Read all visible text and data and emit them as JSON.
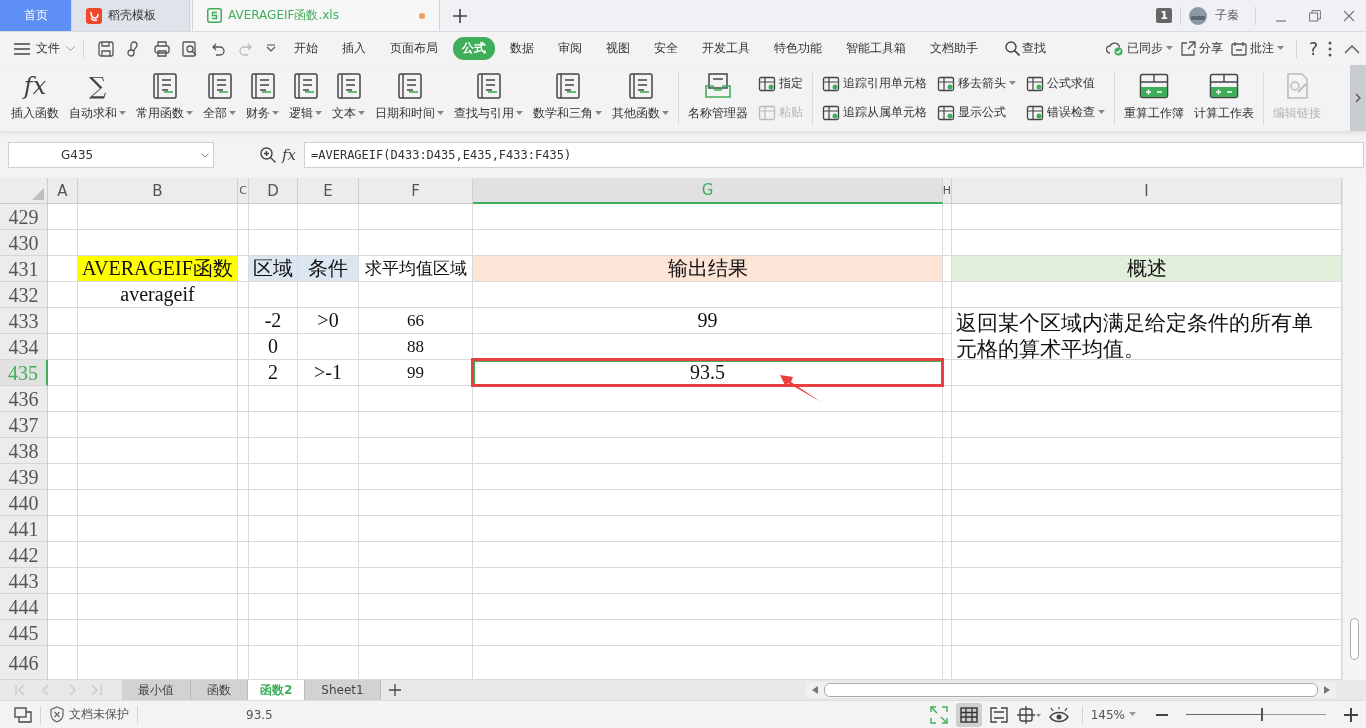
{
  "title_bar": {
    "tabs": [
      {
        "label": "首页",
        "kind": "home",
        "selected": false
      },
      {
        "label": "稻壳模板",
        "kind": "docer",
        "selected": false
      },
      {
        "label": "AVERAGEIF函数.xls",
        "kind": "sheet",
        "selected": true,
        "modified": true
      }
    ],
    "badge": "1",
    "user": "子秦"
  },
  "menu_bar": {
    "file": "文件",
    "items": [
      {
        "label": "开始",
        "selected": false
      },
      {
        "label": "插入",
        "selected": false
      },
      {
        "label": "页面布局",
        "selected": false
      },
      {
        "label": "公式",
        "selected": true
      },
      {
        "label": "数据",
        "selected": false
      },
      {
        "label": "审阅",
        "selected": false
      },
      {
        "label": "视图",
        "selected": false
      },
      {
        "label": "安全",
        "selected": false
      },
      {
        "label": "开发工具",
        "selected": false
      },
      {
        "label": "特色功能",
        "selected": false
      },
      {
        "label": "智能工具箱",
        "selected": false
      },
      {
        "label": "文档助手",
        "selected": false
      }
    ],
    "search": "查找",
    "sync": "已同步",
    "share": "分享",
    "comment": "批注",
    "help": "?"
  },
  "ribbon": [
    {
      "kind": "glyph",
      "glyph": "fx",
      "label": "插入函数",
      "dropdown": false
    },
    {
      "kind": "glyph",
      "glyph": "∑",
      "label": "自动求和",
      "dropdown": true
    },
    {
      "kind": "book",
      "label": "常用函数",
      "dropdown": true
    },
    {
      "kind": "book",
      "label": "全部",
      "dropdown": true
    },
    {
      "kind": "book",
      "label": "财务",
      "dropdown": true
    },
    {
      "kind": "book",
      "label": "逻辑",
      "dropdown": true
    },
    {
      "kind": "book",
      "label": "文本",
      "dropdown": true
    },
    {
      "kind": "book",
      "label": "日期和时间",
      "dropdown": true
    },
    {
      "kind": "book",
      "label": "查找与引用",
      "dropdown": true
    },
    {
      "kind": "book",
      "label": "数学和三角",
      "dropdown": true
    },
    {
      "kind": "book",
      "label": "其他函数",
      "dropdown": true
    },
    {
      "kind": "divider"
    },
    {
      "kind": "tray",
      "label": "名称管理器",
      "dropdown": false
    },
    {
      "kind": "stack",
      "items": [
        {
          "label": "指定",
          "dropdown": false,
          "disabled": false
        },
        {
          "label": "粘贴",
          "dropdown": false,
          "disabled": true
        }
      ]
    },
    {
      "kind": "divider"
    },
    {
      "kind": "stack",
      "items": [
        {
          "label": "追踪引用单元格",
          "dropdown": false,
          "disabled": false
        },
        {
          "label": "追踪从属单元格",
          "dropdown": false,
          "disabled": false
        }
      ]
    },
    {
      "kind": "stack",
      "items": [
        {
          "label": "移去箭头",
          "dropdown": true,
          "disabled": false
        },
        {
          "label": "显示公式",
          "dropdown": false,
          "disabled": false
        }
      ]
    },
    {
      "kind": "stack",
      "items": [
        {
          "label": "公式求值",
          "dropdown": false,
          "disabled": false
        },
        {
          "label": "错误检查",
          "dropdown": true,
          "disabled": false
        }
      ]
    },
    {
      "kind": "divider"
    },
    {
      "kind": "sheet",
      "label": "重算工作簿",
      "dropdown": false
    },
    {
      "kind": "sheet",
      "label": "计算工作表",
      "dropdown": false
    },
    {
      "kind": "divider"
    },
    {
      "kind": "link",
      "label": "编辑链接",
      "dropdown": false,
      "disabled": true
    }
  ],
  "formula_bar": {
    "cell": "G435",
    "fx": "fx",
    "formula": "=AVERAGEIF(D433:D435,E435,F433:F435)"
  },
  "columns": [
    {
      "label": "A",
      "selected": false
    },
    {
      "label": "B",
      "selected": false
    },
    {
      "label": "C",
      "selected": false
    },
    {
      "label": "D",
      "selected": false
    },
    {
      "label": "E",
      "selected": false
    },
    {
      "label": "F",
      "selected": false
    },
    {
      "label": "G",
      "selected": true
    },
    {
      "label": "H",
      "selected": false
    },
    {
      "label": "I",
      "selected": false
    }
  ],
  "rows": [
    {
      "label": "429",
      "selected": false
    },
    {
      "label": "430",
      "selected": false
    },
    {
      "label": "431",
      "selected": false,
      "cells": {
        "B": {
          "text": "AVERAGEIF函数",
          "color": "#ffff00"
        },
        "D": {
          "text": "区域",
          "color": "#dce6f1"
        },
        "E": {
          "text": "条件",
          "color": "#dce6f1"
        },
        "F": {
          "text": "求平均值区域"
        },
        "G": {
          "text": "输出结果",
          "color": "#fce4d6"
        },
        "I": {
          "text": "概述",
          "color": "#e2efda"
        }
      }
    },
    {
      "label": "432",
      "selected": false,
      "cells": {
        "B": {
          "text": "averageif"
        }
      }
    },
    {
      "label": "433",
      "selected": false,
      "cells": {
        "D": {
          "text": "-2"
        },
        "E": {
          "text": ">0"
        },
        "F": {
          "text": "66"
        },
        "G": {
          "text": "99"
        },
        "I": {
          "text": "返回某个区域内满足给定条件的所有单元格的算术平均值。",
          "merged_down": true
        }
      }
    },
    {
      "label": "434",
      "selected": false,
      "cells": {
        "D": {
          "text": "0"
        },
        "F": {
          "text": "88"
        }
      }
    },
    {
      "label": "435",
      "selected": true,
      "cells": {
        "D": {
          "text": "2"
        },
        "E": {
          "text": ">-1"
        },
        "F": {
          "text": "99"
        },
        "G": {
          "text": "93.5",
          "selected": true,
          "highlighted": true
        }
      }
    },
    {
      "label": "436",
      "selected": false
    },
    {
      "label": "437",
      "selected": false
    },
    {
      "label": "438",
      "selected": false
    },
    {
      "label": "439",
      "selected": false
    },
    {
      "label": "440",
      "selected": false
    },
    {
      "label": "441",
      "selected": false
    },
    {
      "label": "442",
      "selected": false
    },
    {
      "label": "443",
      "selected": false
    },
    {
      "label": "444",
      "selected": false
    },
    {
      "label": "445",
      "selected": false
    },
    {
      "label": "446",
      "selected": false
    }
  ],
  "sheet_tabs": [
    {
      "label": "最小值",
      "selected": false
    },
    {
      "label": "函数",
      "selected": false
    },
    {
      "label": "函数2",
      "selected": true
    },
    {
      "label": "Sheet1",
      "selected": false
    }
  ],
  "status_bar": {
    "protection": "文档未保护",
    "value": "93.5",
    "views": [
      {
        "kind": "fullscreen",
        "selected": false
      },
      {
        "kind": "normal",
        "selected": true
      },
      {
        "kind": "pagebreak",
        "selected": false
      },
      {
        "kind": "layout",
        "selected": false
      },
      {
        "kind": "eye",
        "selected": false
      }
    ],
    "zoom": "145%",
    "zoom_slider": {
      "level": 0.55
    }
  }
}
